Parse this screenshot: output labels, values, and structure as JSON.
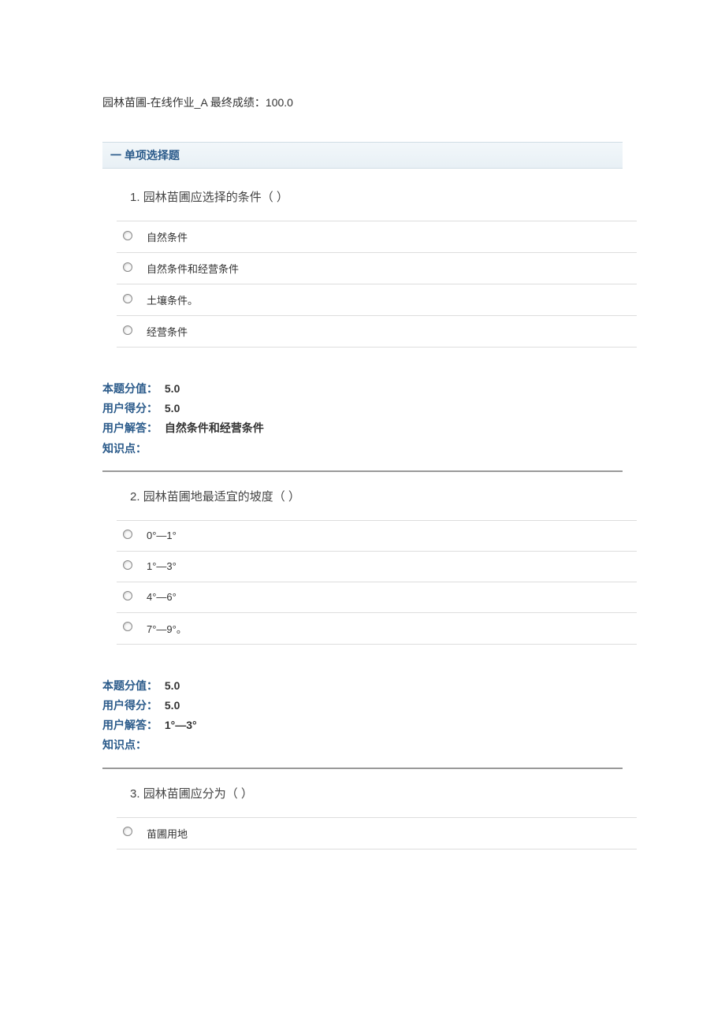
{
  "title": "园林苗圃-在线作业_A 最终成绩：100.0",
  "section_header": "一  单项选择题",
  "questions": [
    {
      "num": "1.",
      "text": "园林苗圃应选择的条件（ ）",
      "options": [
        "自然条件",
        "自然条件和经营条件",
        "土壤条件。",
        "经营条件"
      ],
      "score_label": "本题分值：",
      "score_value": "5.0",
      "user_score_label": "用户得分：",
      "user_score_value": "5.0",
      "user_answer_label": "用户解答：",
      "user_answer_value": "自然条件和经营条件",
      "knowledge_label": "知识点："
    },
    {
      "num": "2.",
      "text": "园林苗圃地最适宜的坡度（ ）",
      "options": [
        "0°—1°",
        "1°—3°",
        "4°—6°",
        "7°—9°。"
      ],
      "score_label": "本题分值：",
      "score_value": "5.0",
      "user_score_label": "用户得分：",
      "user_score_value": "5.0",
      "user_answer_label": "用户解答：",
      "user_answer_value": "1°—3°",
      "knowledge_label": "知识点："
    },
    {
      "num": "3.",
      "text": "园林苗圃应分为（ ）",
      "options": [
        "苗圃用地"
      ]
    }
  ]
}
